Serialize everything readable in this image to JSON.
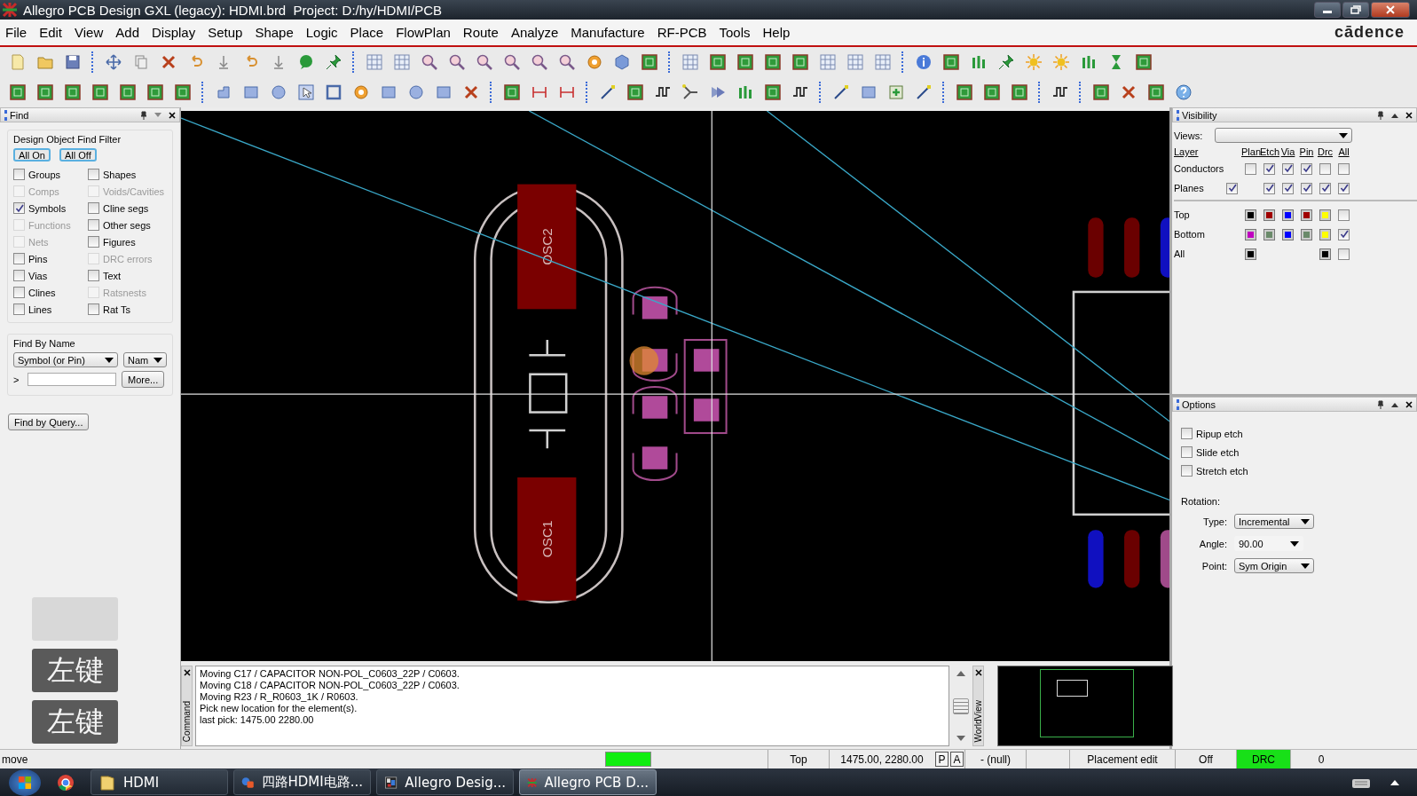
{
  "window": {
    "title": "Allegro PCB Design GXL (legacy): HDMI.brd  Project: D:/hy/HDMI/PCB"
  },
  "menu": [
    "File",
    "Edit",
    "View",
    "Add",
    "Display",
    "Setup",
    "Shape",
    "Logic",
    "Place",
    "FlowPlan",
    "Route",
    "Analyze",
    "Manufacture",
    "RF-PCB",
    "Tools",
    "Help"
  ],
  "brand": "cādence",
  "find_panel": {
    "title": "Find",
    "filter_title": "Design Object Find Filter",
    "buttons": [
      "All On",
      "All Off"
    ],
    "filters": [
      {
        "label": "Groups",
        "checked": false,
        "disabled": false
      },
      {
        "label": "Shapes",
        "checked": false,
        "disabled": false
      },
      {
        "label": "Comps",
        "checked": false,
        "disabled": true
      },
      {
        "label": "Voids/Cavities",
        "checked": false,
        "disabled": true
      },
      {
        "label": "Symbols",
        "checked": true,
        "disabled": false
      },
      {
        "label": "Cline segs",
        "checked": false,
        "disabled": false
      },
      {
        "label": "Functions",
        "checked": false,
        "disabled": true
      },
      {
        "label": "Other segs",
        "checked": false,
        "disabled": false
      },
      {
        "label": "Nets",
        "checked": false,
        "disabled": true
      },
      {
        "label": "Figures",
        "checked": false,
        "disabled": false
      },
      {
        "label": "Pins",
        "checked": false,
        "disabled": false
      },
      {
        "label": "DRC errors",
        "checked": false,
        "disabled": true
      },
      {
        "label": "Vias",
        "checked": false,
        "disabled": false
      },
      {
        "label": "Text",
        "checked": false,
        "disabled": false
      },
      {
        "label": "Clines",
        "checked": false,
        "disabled": false
      },
      {
        "label": "Ratsnests",
        "checked": false,
        "disabled": true
      },
      {
        "label": "Lines",
        "checked": false,
        "disabled": false
      },
      {
        "label": "Rat Ts",
        "checked": false,
        "disabled": false
      }
    ],
    "find_by_name": {
      "title": "Find By Name",
      "object_type": "Symbol (or Pin)",
      "match": "Nam",
      "prompt": ">",
      "more_button": "More..."
    },
    "query_button": "Find by Query..."
  },
  "key_overlay": [
    "左键",
    "左键"
  ],
  "canvas": {
    "pad_labels": [
      "OSC2",
      "OSC1"
    ]
  },
  "command": {
    "tab": "Command",
    "lines": [
      "Moving C17 / CAPACITOR NON-POL_C0603_22P / C0603.",
      "Moving C18 / CAPACITOR NON-POL_C0603_22P / C0603.",
      "Moving R23 / R_R0603_1K / R0603.",
      "Pick new location for the element(s).",
      "last pick:  1475.00 2280.00"
    ]
  },
  "worldview": {
    "tab": "WorldView"
  },
  "visibility": {
    "title": "Visibility",
    "views_label": "Views:",
    "columns": [
      "Layer",
      "Plan",
      "Etch",
      "Via",
      "Pin",
      "Drc",
      "All"
    ],
    "rows": [
      {
        "label": "Conductors",
        "cells": [
          {
            "kind": "checkbox",
            "checked": false
          },
          {
            "kind": "checkbox",
            "checked": true
          },
          {
            "kind": "checkbox",
            "checked": true
          },
          {
            "kind": "checkbox",
            "checked": true
          },
          {
            "kind": "checkbox",
            "checked": false
          },
          {
            "kind": "checkbox",
            "checked": false
          }
        ]
      },
      {
        "label": "Planes",
        "label_checked": true,
        "cells": [
          {
            "kind": "none"
          },
          {
            "kind": "checkbox",
            "checked": true
          },
          {
            "kind": "checkbox",
            "checked": true
          },
          {
            "kind": "checkbox",
            "checked": true
          },
          {
            "kind": "checkbox",
            "checked": true
          },
          {
            "kind": "checkbox",
            "checked": true
          }
        ]
      }
    ],
    "layers": [
      {
        "label": "Top",
        "cells": [
          {
            "kind": "swatch",
            "color": "#000000"
          },
          {
            "kind": "swatch",
            "color": "#a00000"
          },
          {
            "kind": "swatch",
            "color": "#0000ff"
          },
          {
            "kind": "swatch",
            "color": "#a00000"
          },
          {
            "kind": "swatch",
            "color": "#ffff00"
          },
          {
            "kind": "checkbox",
            "checked": false
          }
        ]
      },
      {
        "label": "Bottom",
        "cells": [
          {
            "kind": "swatch",
            "color": "#c000c0"
          },
          {
            "kind": "swatch",
            "color": "#6a8a6a"
          },
          {
            "kind": "swatch",
            "color": "#0000ff"
          },
          {
            "kind": "swatch",
            "color": "#6a8a6a"
          },
          {
            "kind": "swatch",
            "color": "#ffff00"
          },
          {
            "kind": "checkbox",
            "checked": true
          }
        ]
      },
      {
        "label": "All",
        "cells": [
          {
            "kind": "swatch",
            "color": "#000000"
          },
          {
            "kind": "none"
          },
          {
            "kind": "none"
          },
          {
            "kind": "none"
          },
          {
            "kind": "swatch",
            "color": "#000000"
          },
          {
            "kind": "checkbox",
            "checked": false
          }
        ]
      }
    ]
  },
  "options": {
    "title": "Options",
    "checks": [
      {
        "label": "Ripup etch",
        "checked": false
      },
      {
        "label": "Slide etch",
        "checked": false
      },
      {
        "label": "Stretch etch",
        "checked": false
      }
    ],
    "rotation_label": "Rotation:",
    "fields": [
      {
        "label": "Type:",
        "value": "Incremental",
        "kind": "dropdown"
      },
      {
        "label": "Angle:",
        "value": "90.00",
        "kind": "combo"
      },
      {
        "label": "Point:",
        "value": "Sym Origin",
        "kind": "dropdown"
      }
    ]
  },
  "status_bar": {
    "command": "move",
    "busy": false,
    "fields": [
      {
        "kind": "text",
        "text": "Top"
      },
      {
        "kind": "text",
        "text": "1475.00, 2280.00"
      },
      {
        "kind": "toggle",
        "text": "P"
      },
      {
        "kind": "toggle",
        "text": "A"
      },
      {
        "kind": "text",
        "text": "- (null)"
      },
      {
        "kind": "blank"
      },
      {
        "kind": "text",
        "text": "Placement edit"
      },
      {
        "kind": "text",
        "text": "Off"
      },
      {
        "kind": "indicator",
        "text": "DRC",
        "on": true
      },
      {
        "kind": "text",
        "text": "0"
      }
    ]
  },
  "taskbar": {
    "items": [
      {
        "kind": "folder",
        "label": "HDMI",
        "selected": false
      },
      {
        "kind": "document",
        "label": "四路HDMI电路...",
        "selected": false
      },
      {
        "kind": "app",
        "label": "Allegro Desig...",
        "selected": false
      },
      {
        "kind": "allegro",
        "label": "Allegro PCB D...",
        "selected": true
      }
    ]
  }
}
